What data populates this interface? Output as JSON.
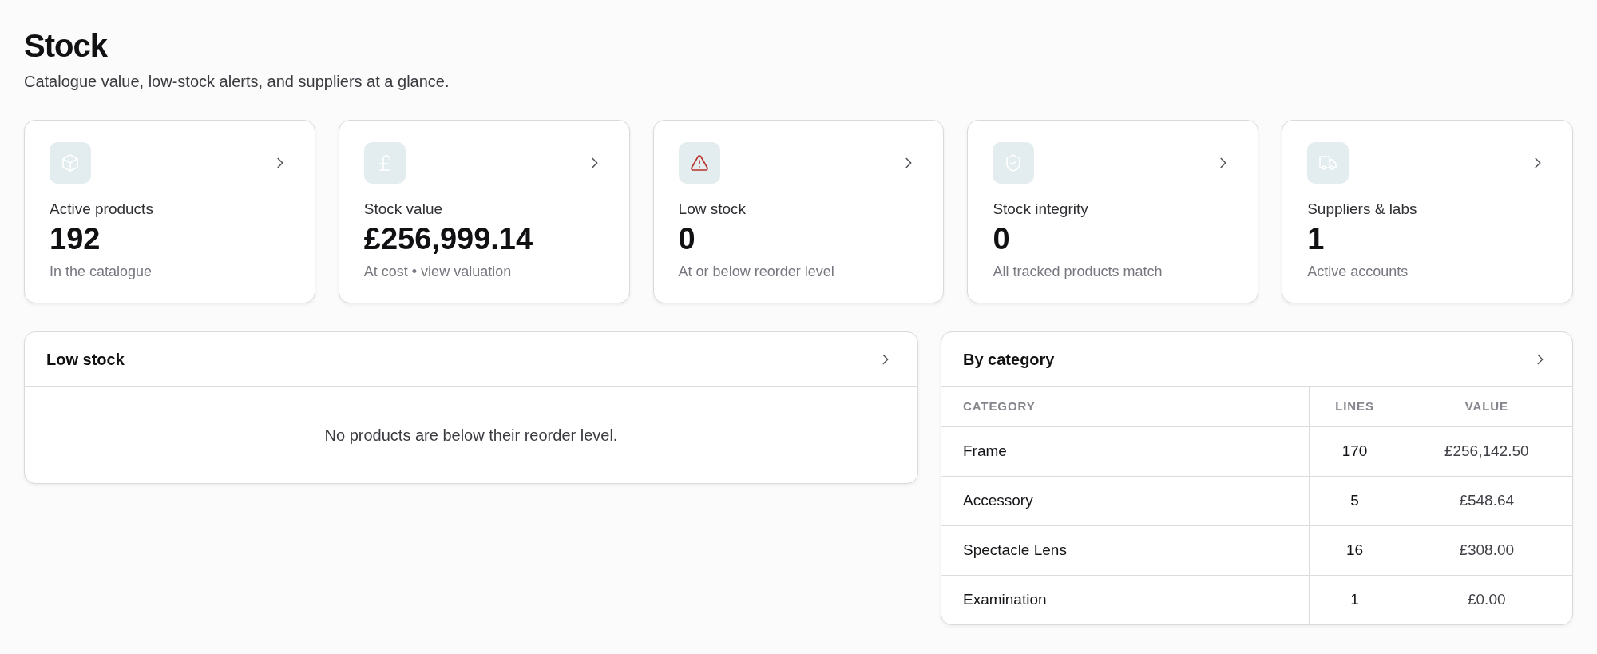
{
  "page": {
    "title": "Stock",
    "subtitle": "Catalogue value, low-stock alerts, and suppliers at a glance."
  },
  "stat_cards": [
    {
      "label": "Active products",
      "value": "192",
      "caption": "In the catalogue"
    },
    {
      "label": "Stock value",
      "value": "£256,999.14",
      "caption": "At cost • view valuation"
    },
    {
      "label": "Low stock",
      "value": "0",
      "caption": "At or below reorder level"
    },
    {
      "label": "Stock integrity",
      "value": "0",
      "caption": "All tracked products match"
    },
    {
      "label": "Suppliers & labs",
      "value": "1",
      "caption": "Active accounts"
    }
  ],
  "low_stock": {
    "title": "Low stock",
    "empty_message": "No products are below their reorder level."
  },
  "by_category": {
    "title": "By category",
    "columns": [
      "CATEGORY",
      "LINES",
      "VALUE"
    ],
    "rows": [
      [
        "Frame",
        "170",
        "£256,142.50"
      ],
      [
        "Accessory",
        "5",
        "£548.64"
      ],
      [
        "Spectacle Lens",
        "16",
        "£308.00"
      ],
      [
        "Examination",
        "1",
        "£0.00"
      ]
    ]
  }
}
